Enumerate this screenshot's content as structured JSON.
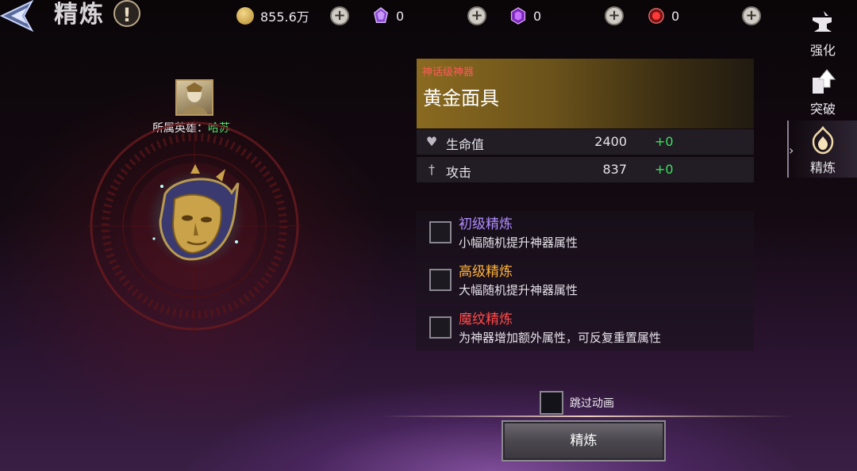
{
  "header": {
    "title": "精炼",
    "help_label": "!"
  },
  "resources": [
    {
      "name": "gold",
      "value": "855.6万",
      "color": "#c9a24a"
    },
    {
      "name": "purple-crystal",
      "value": "0",
      "color": "#8a4ad0"
    },
    {
      "name": "violet-gem",
      "value": "0",
      "color": "#b040e0"
    },
    {
      "name": "red-gem",
      "value": "0",
      "color": "#d23030"
    }
  ],
  "plus_label": "+",
  "side_nav": {
    "items": [
      {
        "label": "强化",
        "icon": "anvil-icon"
      },
      {
        "label": "突破",
        "icon": "upgrade-arrow-icon"
      },
      {
        "label": "精炼",
        "icon": "refine-flame-icon",
        "active": true
      }
    ],
    "arrow": "›"
  },
  "hero": {
    "label": "所属英雄：",
    "name": "哈苏"
  },
  "item": {
    "grade": "神话级神器",
    "name": "黄金面具",
    "grade_color": "#ff5a5a"
  },
  "stats": [
    {
      "name": "生命值",
      "value": "2400",
      "bonus": "+0",
      "icon": "heart-icon"
    },
    {
      "name": "攻击",
      "value": "837",
      "bonus": "+0",
      "icon": "sword-icon"
    }
  ],
  "options": [
    {
      "title": "初级精炼",
      "desc": "小幅随机提升神器属性",
      "color": "#b08cff"
    },
    {
      "title": "高级精炼",
      "desc": "大幅随机提升神器属性",
      "color": "#ffb23a"
    },
    {
      "title": "魔纹精炼",
      "desc": "为神器增加额外属性，可反复重置属性",
      "color": "#ff4a4a"
    }
  ],
  "skip_animation_label": "跳过动画",
  "refine_button_label": "精炼"
}
